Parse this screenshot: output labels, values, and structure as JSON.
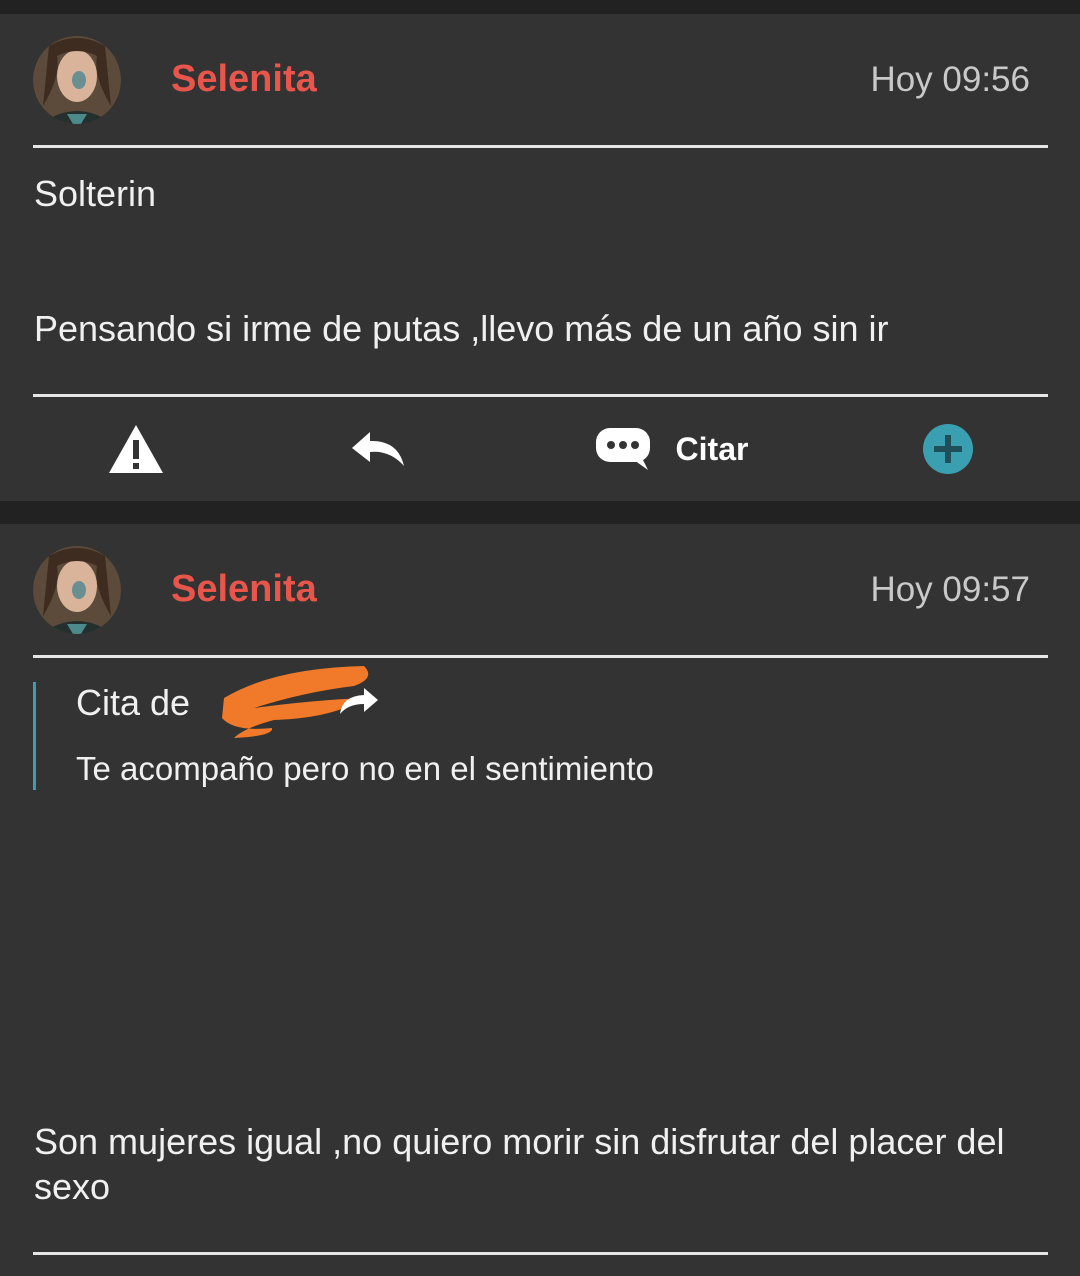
{
  "posts": [
    {
      "author": "Selenita",
      "time": "Hoy 09:56",
      "paragraphs": [
        "Solterin",
        "Pensando si irme de putas ,llevo más de un año sin ir"
      ],
      "actions": {
        "report_icon": "warning-icon",
        "reply_icon": "reply-arrow-icon",
        "quote_label": "Citar",
        "more_icon": "plus-circle-icon"
      }
    },
    {
      "author": "Selenita",
      "time": "Hoy 09:57",
      "quote": {
        "prefix": "Cita de",
        "text": "Te acompaño pero no en el sentimiento"
      },
      "paragraphs": [
        "Son mujeres igual ,no quiero morir sin disfrutar del placer del sexo"
      ]
    }
  ],
  "colors": {
    "username": "#e8554a",
    "accent": "#3a9fb0",
    "background": "#333333"
  }
}
